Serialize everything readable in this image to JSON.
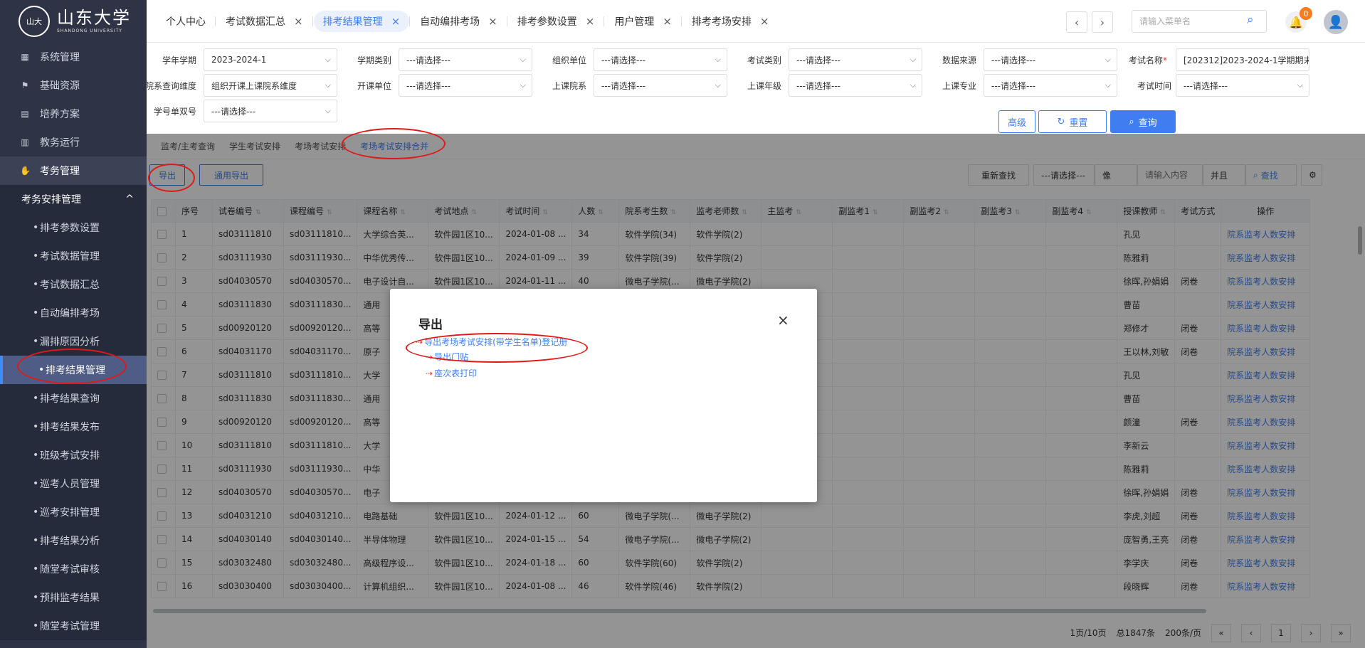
{
  "logo": {
    "seal": "山大",
    "text": "山东大学",
    "sub": "SHANDONG UNIVERSITY"
  },
  "sidebar": {
    "top_items": [
      {
        "label": "系统管理",
        "icon": "grid-icon"
      },
      {
        "label": "基础资源",
        "icon": "flag-icon"
      },
      {
        "label": "培养方案",
        "icon": "book-icon"
      },
      {
        "label": "教务运行",
        "icon": "document-icon"
      },
      {
        "label": "考务管理",
        "icon": "hand-icon"
      }
    ],
    "group": {
      "label": "考务安排管理",
      "chevron": "^"
    },
    "sub_items": [
      "排考参数设置",
      "考试数据管理",
      "考试数据汇总",
      "自动编排考场",
      "漏排原因分析",
      "排考结果管理",
      "排考结果查询",
      "排考结果发布",
      "班级考试安排",
      "巡考人员管理",
      "巡考安排管理",
      "排考结果分析",
      "随堂考试审核",
      "预排监考结果",
      "随堂考试管理"
    ]
  },
  "tabs": [
    {
      "label": "个人中心",
      "closable": false
    },
    {
      "label": "考试数据汇总",
      "closable": true
    },
    {
      "label": "排考结果管理",
      "closable": true,
      "active": true
    },
    {
      "label": "自动编排考场",
      "closable": true
    },
    {
      "label": "排考参数设置",
      "closable": true
    },
    {
      "label": "用户管理",
      "closable": true
    },
    {
      "label": "排考考场安排",
      "closable": true
    }
  ],
  "header": {
    "prev": "‹",
    "next": "›",
    "search_placeholder": "请输入菜单名",
    "badge": "0",
    "close_glyph": "×"
  },
  "filters": {
    "labels": [
      "学年学期",
      "学期类别",
      "组织单位",
      "考试类别",
      "数据来源",
      "考试名称",
      "院系查询维度",
      "开课单位",
      "上课院系",
      "上课年级",
      "上课专业",
      "考试时间",
      "学号单双号"
    ],
    "values": [
      "2023-2024-1",
      "---请选择---",
      "---请选择---",
      "---请选择---",
      "---请选择---",
      "[202312]2023-2024-1学期期末",
      "组织开课上课院系维度",
      "---请选择---",
      "---请选择---",
      "---请选择---",
      "---请选择---",
      "---请选择---",
      "---请选择---"
    ],
    "required_mark": "*",
    "advanced": "高级",
    "reset": "重置",
    "query": "查询"
  },
  "subtabs": [
    "监考/主考查询",
    "学生考试安排",
    "考场考试安排",
    "考场考试安排合并"
  ],
  "toolbar": {
    "export": "导出",
    "general_export": "通用导出",
    "refind": "重新查找",
    "select": "---请选择---",
    "match": "像",
    "search_placeholder": "请输入内容",
    "combine": "并且",
    "find": "查找"
  },
  "table": {
    "headers": [
      "序号",
      "试卷编号",
      "课程编号",
      "课程名称",
      "考试地点",
      "考试时间",
      "人数",
      "院系考生数",
      "监考老师数",
      "主监考",
      "副监考1",
      "副监考2",
      "副监考3",
      "副监考4",
      "授课教师",
      "考试方式",
      "操作"
    ],
    "rows": [
      [
        "1",
        "sd03111810",
        "sd03111810...",
        "大学综合英...",
        "软件园1区10...",
        "2024-01-08 ...",
        "34",
        "软件学院(34)",
        "软件学院(2)",
        "",
        "",
        "",
        "",
        "",
        "孔见",
        "",
        "院系监考人数安排"
      ],
      [
        "2",
        "sd03111930",
        "sd03111930...",
        "中华优秀传...",
        "软件园1区10...",
        "2024-01-09 ...",
        "39",
        "软件学院(39)",
        "软件学院(2)",
        "",
        "",
        "",
        "",
        "",
        "陈雅莉",
        "",
        "院系监考人数安排"
      ],
      [
        "3",
        "sd04030570",
        "sd04030570...",
        "电子设计自...",
        "软件园1区10...",
        "2024-01-11 ...",
        "40",
        "微电子学院(...",
        "微电子学院(2)",
        "",
        "",
        "",
        "",
        "",
        "徐晖,孙娟娟",
        "闭卷",
        "院系监考人数安排"
      ],
      [
        "4",
        "sd03111830",
        "sd03111830...",
        "通用",
        "",
        "",
        "",
        "",
        "",
        "",
        "",
        "",
        "",
        "",
        "曹苗",
        "",
        "院系监考人数安排"
      ],
      [
        "5",
        "sd00920120",
        "sd00920120...",
        "高等",
        "",
        "",
        "",
        "",
        "",
        "",
        "",
        "",
        "",
        "",
        "郑修才",
        "闭卷",
        "院系监考人数安排"
      ],
      [
        "6",
        "sd04031170",
        "sd04031170...",
        "原子",
        "",
        "",
        "",
        "",
        "",
        "",
        "",
        "",
        "",
        "",
        "王以林,刘敏",
        "闭卷",
        "院系监考人数安排"
      ],
      [
        "7",
        "sd03111810",
        "sd03111810...",
        "大学",
        "",
        "",
        "",
        "",
        "",
        "",
        "",
        "",
        "",
        "",
        "孔见",
        "",
        "院系监考人数安排"
      ],
      [
        "8",
        "sd03111830",
        "sd03111830...",
        "通用",
        "",
        "",
        "",
        "",
        "",
        "",
        "",
        "",
        "",
        "",
        "曹苗",
        "",
        "院系监考人数安排"
      ],
      [
        "9",
        "sd00920120",
        "sd00920120...",
        "高等",
        "",
        "",
        "",
        "",
        "",
        "",
        "",
        "",
        "",
        "",
        "颜潼",
        "闭卷",
        "院系监考人数安排"
      ],
      [
        "10",
        "sd03111810",
        "sd03111810...",
        "大学",
        "",
        "",
        "",
        "",
        "",
        "",
        "",
        "",
        "",
        "",
        "李新云",
        "",
        "院系监考人数安排"
      ],
      [
        "11",
        "sd03111930",
        "sd03111930...",
        "中华",
        "",
        "",
        "",
        "",
        "",
        "",
        "",
        "",
        "",
        "",
        "陈雅莉",
        "",
        "院系监考人数安排"
      ],
      [
        "12",
        "sd04030570",
        "sd04030570...",
        "电子",
        "",
        "",
        "",
        "",
        "",
        "",
        "",
        "",
        "",
        "",
        "徐晖,孙娟娟",
        "闭卷",
        "院系监考人数安排"
      ],
      [
        "13",
        "sd04031210",
        "sd04031210...",
        "电路基础",
        "软件园1区10...",
        "2024-01-12 ...",
        "60",
        "微电子学院(...",
        "微电子学院(2)",
        "",
        "",
        "",
        "",
        "",
        "李虎,刘超",
        "闭卷",
        "院系监考人数安排"
      ],
      [
        "14",
        "sd04030140",
        "sd04030140...",
        "半导体物理",
        "软件园1区10...",
        "2024-01-15 ...",
        "54",
        "微电子学院(...",
        "微电子学院(2)",
        "",
        "",
        "",
        "",
        "",
        "庞智勇,王亮",
        "闭卷",
        "院系监考人数安排"
      ],
      [
        "15",
        "sd03032480",
        "sd03032480...",
        "高级程序设...",
        "软件园1区10...",
        "2024-01-18 ...",
        "60",
        "软件学院(60)",
        "软件学院(2)",
        "",
        "",
        "",
        "",
        "",
        "李学庆",
        "闭卷",
        "院系监考人数安排"
      ],
      [
        "16",
        "sd03030400",
        "sd03030400...",
        "计算机组织...",
        "软件园1区10...",
        "2024-01-08 ...",
        "46",
        "软件学院(46)",
        "软件学院(2)",
        "",
        "",
        "",
        "",
        "",
        "段晓辉",
        "闭卷",
        "院系监考人数安排"
      ]
    ]
  },
  "pager": {
    "pages": "1页/10页",
    "total": "总1847条",
    "per_page": "200条/页",
    "current": "1"
  },
  "modal": {
    "title": "导出",
    "links": [
      "导出考场考试安排(带学生名单)登记册",
      "导出门贴",
      "座次表打印"
    ]
  },
  "colors": {
    "accent": "#3f7ef0",
    "sidebar": "#2e3446",
    "annotation": "#e01818"
  }
}
